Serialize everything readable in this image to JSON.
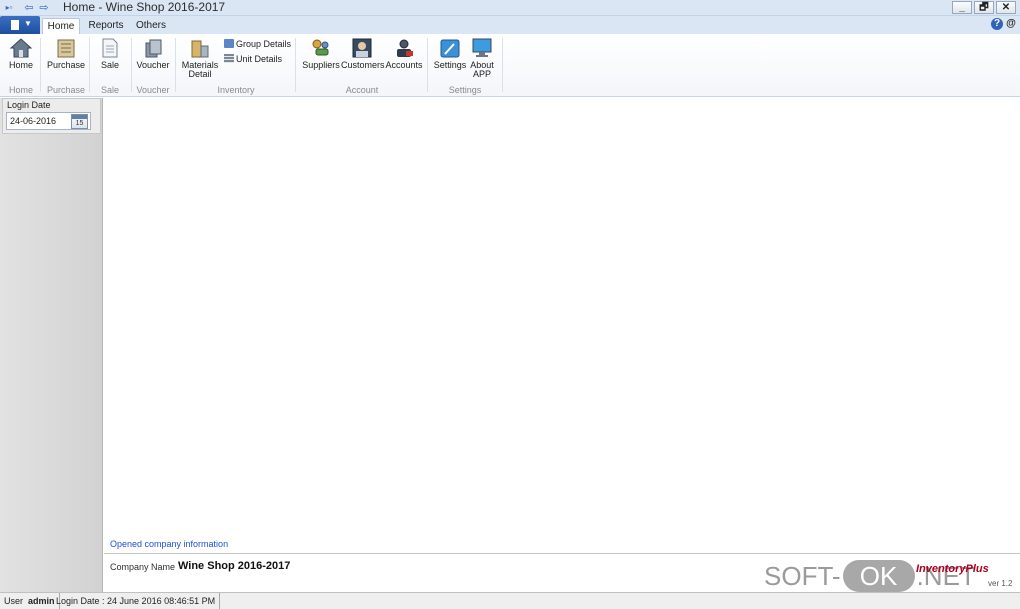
{
  "window": {
    "title": "Home - Wine Shop 2016-2017",
    "minimize_label": "_",
    "restore_label": "🗗",
    "close_label": "✕"
  },
  "tabs": [
    {
      "label": "Home",
      "active": true
    },
    {
      "label": "Reports",
      "active": false
    },
    {
      "label": "Others",
      "active": false
    }
  ],
  "help_icons": [
    "?",
    "@"
  ],
  "ribbon": {
    "buttons": {
      "home": "Home",
      "purchase": "Purchase",
      "sale": "Sale",
      "voucher": "Voucher",
      "materials_line1": "Materials",
      "materials_line2": "Detail",
      "suppliers": "Suppliers",
      "customers": "Customers",
      "accounts": "Accounts",
      "settings": "Settings",
      "about_line1": "About",
      "about_line2": "APP"
    },
    "small_buttons": {
      "group_details": "Group Details",
      "unit_details": "Unit Details"
    },
    "groups": {
      "home": "Home",
      "purchase": "Purchase",
      "sale": "Sale",
      "voucher": "Voucher",
      "inventory": "Inventory",
      "account": "Account",
      "settings": "Settings"
    }
  },
  "left_panel": {
    "login_label": "Login Date",
    "login_date": "24-06-2016",
    "calendar_day": "15"
  },
  "content": {
    "opened_link": "Opened company information",
    "company_label": "Company Name",
    "company_name": "Wine Shop 2016-2017",
    "brand": "InventoryPlus",
    "brand_version": "ver 1.2"
  },
  "watermark": {
    "pre": "SOFT-",
    "ok": "OK",
    "post": ".NET"
  },
  "status": {
    "user_label": "User",
    "user_value": "admin",
    "login_text": "Login Date : 24 June 2016 08:46:51 PM"
  },
  "colors": {
    "accent": "#2e6bc8",
    "link": "#1a4fd6",
    "brand": "#b00020"
  }
}
